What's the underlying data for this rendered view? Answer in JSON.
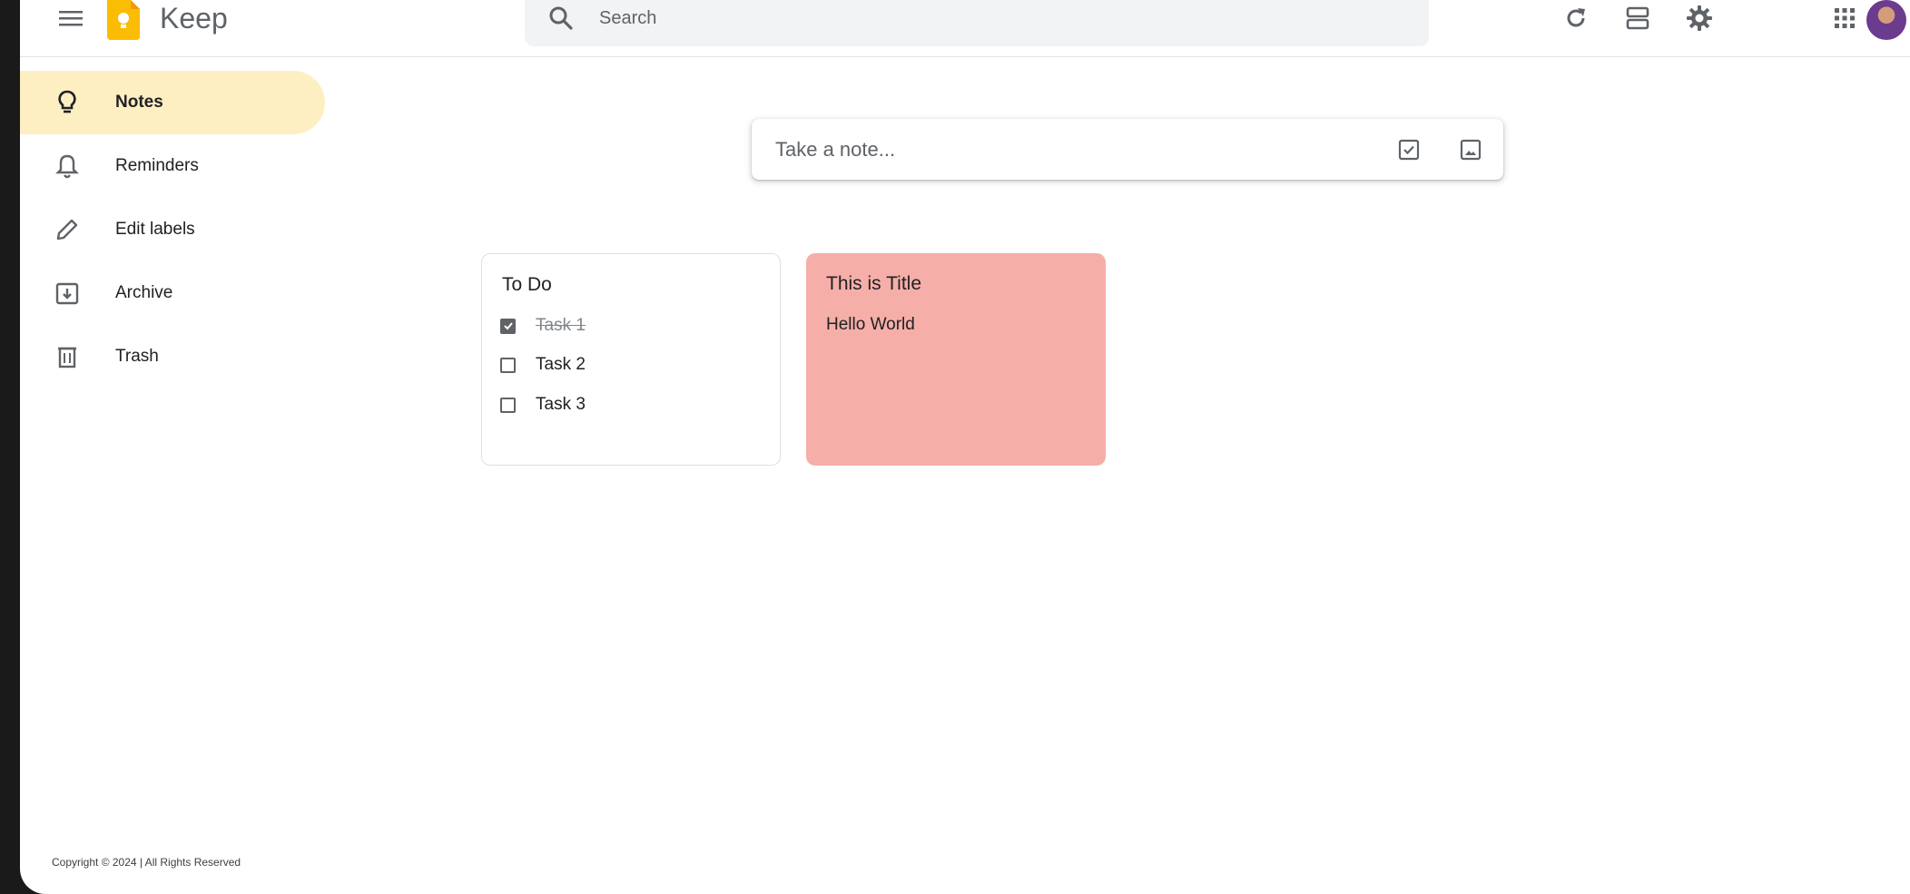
{
  "header": {
    "app_title": "Keep",
    "search_placeholder": "Search",
    "icons": [
      "menu-icon",
      "keep-logo",
      "search-icon",
      "refresh-icon",
      "list-view-icon",
      "settings-icon",
      "apps-grid-icon",
      "avatar"
    ]
  },
  "sidebar": {
    "items": [
      {
        "label": "Notes",
        "icon": "lightbulb-icon",
        "active": true
      },
      {
        "label": "Reminders",
        "icon": "bell-icon",
        "active": false
      },
      {
        "label": "Edit labels",
        "icon": "pencil-icon",
        "active": false
      },
      {
        "label": "Archive",
        "icon": "archive-icon",
        "active": false
      },
      {
        "label": "Trash",
        "icon": "trash-icon",
        "active": false
      }
    ]
  },
  "composer": {
    "placeholder": "Take a note...",
    "icons": [
      "new-list-icon",
      "new-image-icon"
    ]
  },
  "notes": [
    {
      "title": "To Do",
      "color": "#ffffff",
      "tasks": [
        {
          "label": "Task 1",
          "checked": true
        },
        {
          "label": "Task 2",
          "checked": false
        },
        {
          "label": "Task 3",
          "checked": false
        }
      ]
    },
    {
      "title": "This is Title",
      "body": "Hello World",
      "color": "#f6aea9"
    }
  ],
  "footer": {
    "copyright": "Copyright © 2024 | All Rights Reserved"
  },
  "colors": {
    "accent_active": "#feefc3",
    "logo_yellow": "#fbbc04"
  }
}
